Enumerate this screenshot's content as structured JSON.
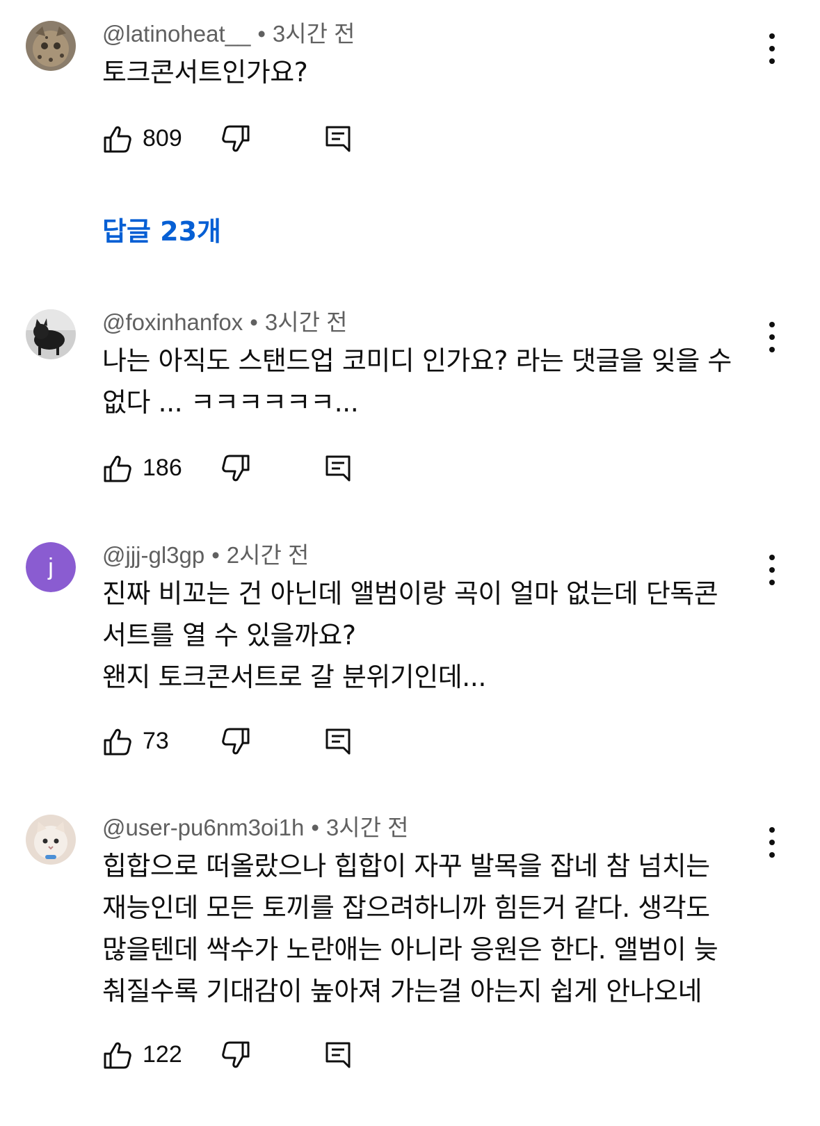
{
  "comments": [
    {
      "handle": "@latinoheat__",
      "time": "3시간 전",
      "lines": [
        "토크콘서트인가요?"
      ],
      "likes": "809",
      "avatar": "leopard-cat-photo",
      "replies_label": "답글 23개"
    },
    {
      "handle": "@foxinhanfox",
      "time": "3시간 전",
      "lines": [
        "나는 아직도 스탠드업 코미디 인가요? 라는 댓글을 잊을 수",
        "없다 ... ㅋㅋㅋㅋㅋㅋ..."
      ],
      "likes": "186",
      "avatar": "black-cat-photo"
    },
    {
      "handle": "@jjj-gl3gp",
      "time": "2시간 전",
      "lines": [
        "진짜 비꼬는 건 아닌데 앨범이랑 곡이 얼마 없는데 단독콘",
        "서트를 열 수 있을까요?",
        "왠지 토크콘서트로 갈 분위기인데..."
      ],
      "likes": "73",
      "avatar_letter": "j",
      "avatar_color": "#8a5cd1"
    },
    {
      "handle": "@user-pu6nm3oi1h",
      "time": "3시간 전",
      "lines": [
        "힙합으로 떠올랐으나 힙합이 자꾸 발목을 잡네 참 넘치는",
        "재능인데 모든 토끼를 잡으려하니까 힘든거 같다. 생각도",
        "많을텐데 싹수가 노란애는 아니라 응원은 한다. 앨범이 늦",
        "춰질수록 기대감이 높아져 가는걸 아는지 쉽게 안나오네"
      ],
      "likes": "122",
      "avatar": "white-cat-photo"
    }
  ],
  "colors": {
    "link": "#065fd4",
    "meta": "#606060",
    "text": "#0f0f0f"
  }
}
